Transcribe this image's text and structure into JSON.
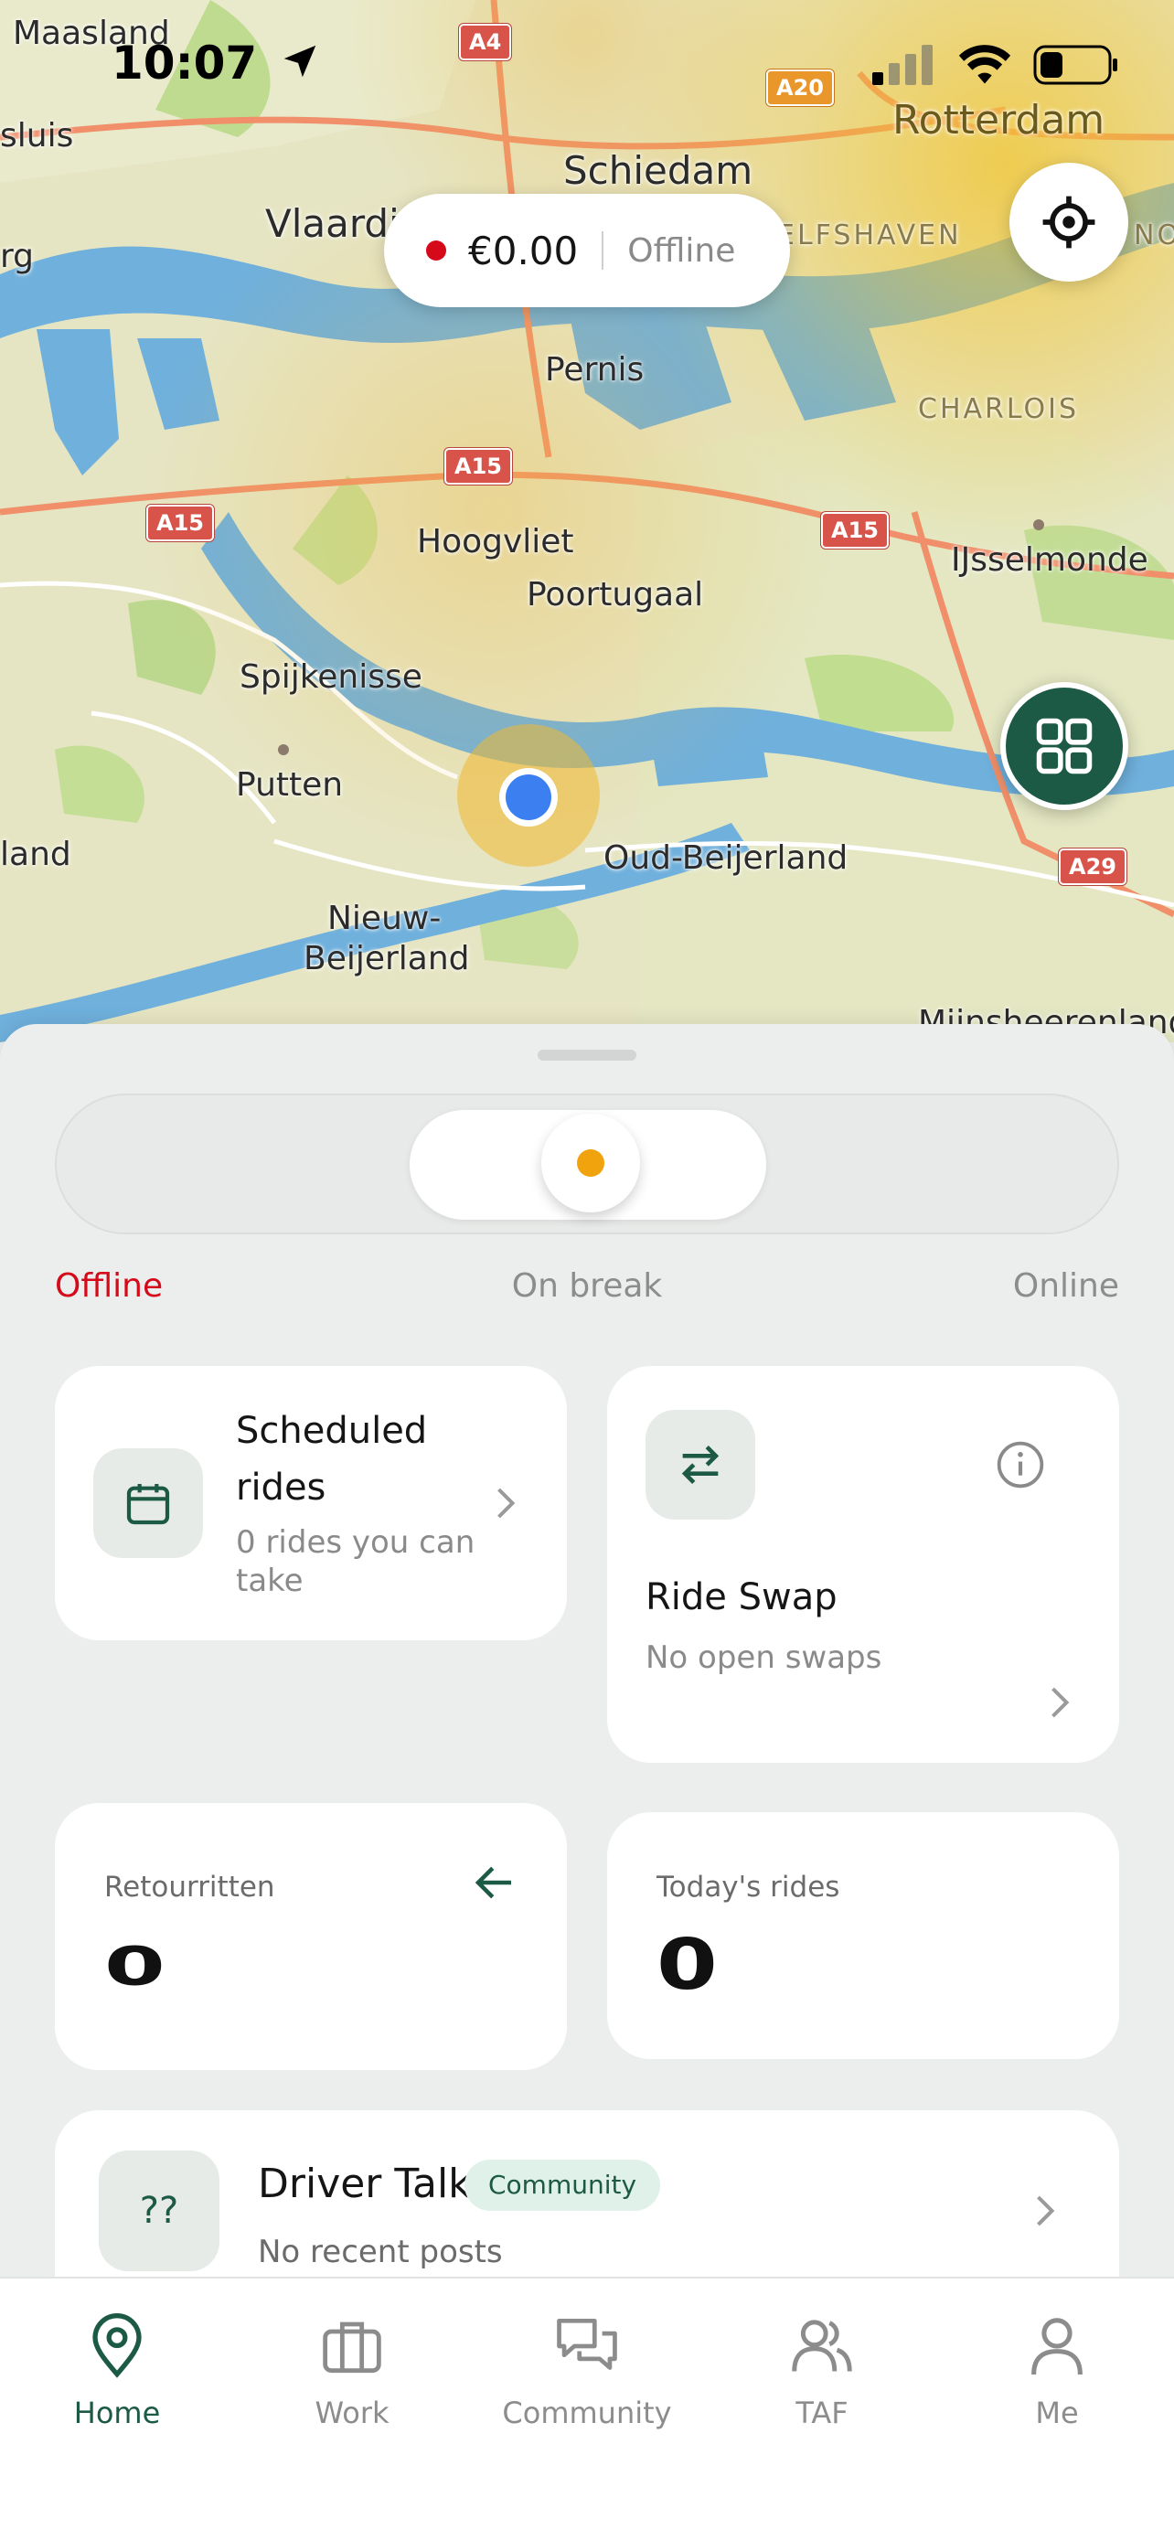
{
  "status_bar": {
    "time": "10:07"
  },
  "map": {
    "places": [
      {
        "name": "Maasland"
      },
      {
        "name": "Rotterdam"
      },
      {
        "name": "Schiedam"
      },
      {
        "name": "Vlaardi"
      },
      {
        "name": "sluis"
      },
      {
        "name": "rg"
      },
      {
        "name": "ELFSHAVEN"
      },
      {
        "name": "Pernis"
      },
      {
        "name": "CHARLOIS"
      },
      {
        "name": "Hoogvliet"
      },
      {
        "name": "Poortugaal"
      },
      {
        "name": "IJsselmonde"
      },
      {
        "name": "Spijkenisse"
      },
      {
        "name": "Putten"
      },
      {
        "name": "land"
      },
      {
        "name": "Oud-Beijerland"
      },
      {
        "name": "Nieuw-"
      },
      {
        "name": "Beijerland"
      },
      {
        "name": "Mijnsheerenland"
      },
      {
        "name": "NO"
      }
    ],
    "roads": [
      "A4",
      "A20",
      "A15",
      "A15",
      "A15",
      "A29"
    ]
  },
  "earnings": {
    "amount": "€0.00",
    "status": "Offline"
  },
  "modes": {
    "offline": "Offline",
    "on_break": "On break",
    "online": "Online"
  },
  "cards": {
    "scheduled": {
      "title": "Scheduled rides",
      "subtitle": "0 rides you can take"
    },
    "swap": {
      "title": "Ride Swap",
      "subtitle": "No open swaps"
    },
    "return": {
      "label": "Retourritten",
      "value": "0"
    },
    "today": {
      "label": "Today's rides",
      "value": "0"
    },
    "talk": {
      "title": "Driver Talk",
      "badge": "Community",
      "subtitle": "No recent posts",
      "icon_text": "??"
    }
  },
  "tabs": [
    {
      "label": "Home",
      "active": true
    },
    {
      "label": "Work"
    },
    {
      "label": "Community"
    },
    {
      "label": "TAF"
    },
    {
      "label": "Me"
    }
  ],
  "colors": {
    "accent": "#1d5a45",
    "offline": "#d5091a",
    "break": "#f0a30c"
  }
}
